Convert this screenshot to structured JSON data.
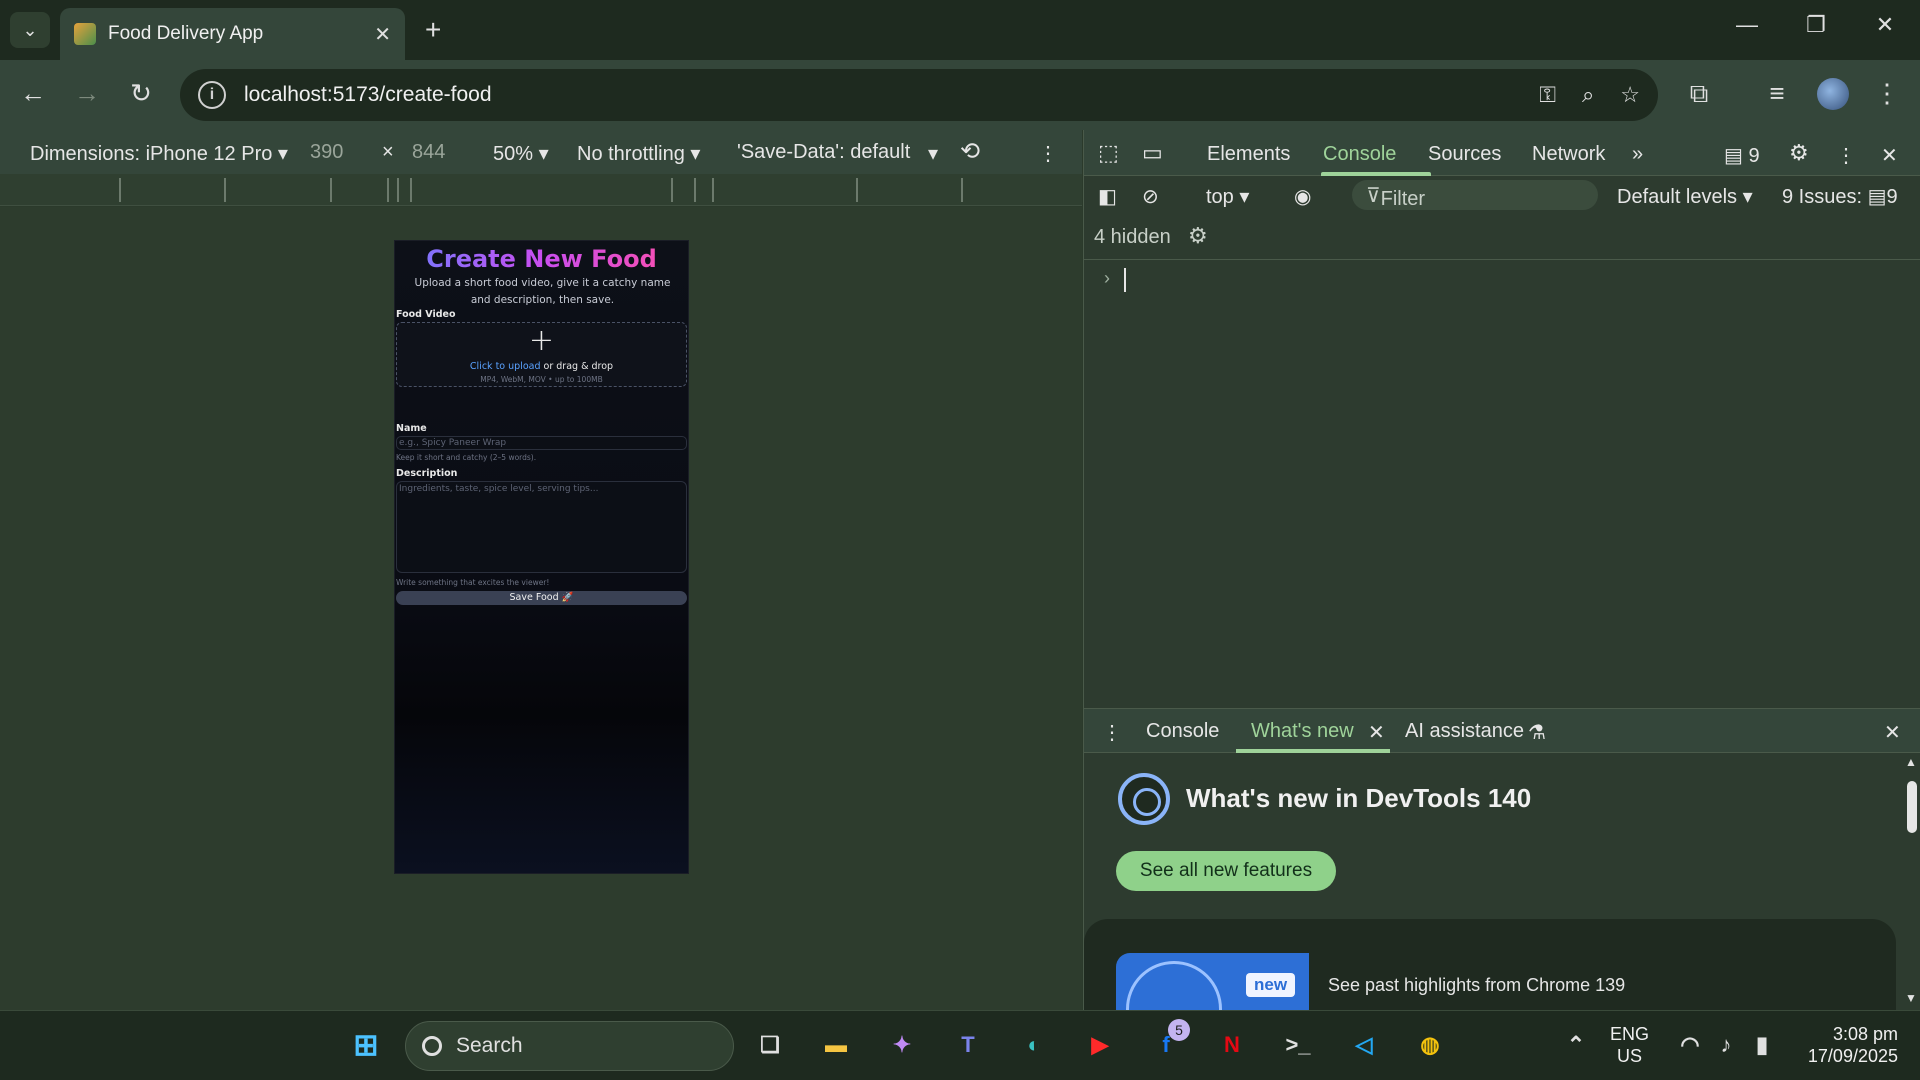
{
  "browser": {
    "tab_title": "Food Delivery App",
    "url": "localhost:5173/create-food"
  },
  "device_toolbar": {
    "dimensions_label": "Dimensions: iPhone 12 Pro",
    "width": "390",
    "times": "×",
    "height": "844",
    "zoom": "50%",
    "throttling": "No throttling",
    "save_data": "'Save-Data': default"
  },
  "page": {
    "title": "Create New Food",
    "subtitle": "Upload a short food video, give it a catchy name and description, then save.",
    "video_label": "Food Video",
    "upload_plus": "+",
    "upload_link": "Click to upload",
    "upload_rest": " or drag & drop",
    "upload_hint": "MP4, WebM, MOV • up to 100MB",
    "name_label": "Name",
    "name_placeholder": "e.g., Spicy Paneer Wrap",
    "name_hint": "Keep it short and catchy (2–5 words).",
    "description_label": "Description",
    "description_placeholder": "Ingredients, taste, spice level, serving tips...",
    "description_hint": "Write something that excites the viewer!",
    "save_button": "Save Food 🚀"
  },
  "devtools": {
    "tabs": [
      "Elements",
      "Console",
      "Sources",
      "Network"
    ],
    "active_tab": "Console",
    "messages_count": "9",
    "context": "top",
    "filter_placeholder": "Filter",
    "levels": "Default levels",
    "issues": "9 Issues:",
    "issues_count": "9",
    "hidden": "4 hidden",
    "drawer_tabs": {
      "console": "Console",
      "whats_new": "What's new",
      "ai": "AI assistance"
    },
    "whats_new_title": "What's new in DevTools 140",
    "see_all": "See all new features",
    "new_badge": "new",
    "past_highlights": "See past highlights from Chrome 139"
  },
  "taskbar": {
    "search": "Search",
    "facebook_badge": "5",
    "lang_top": "ENG",
    "lang_bottom": "US",
    "time": "3:08 pm",
    "date": "17/09/2025"
  }
}
